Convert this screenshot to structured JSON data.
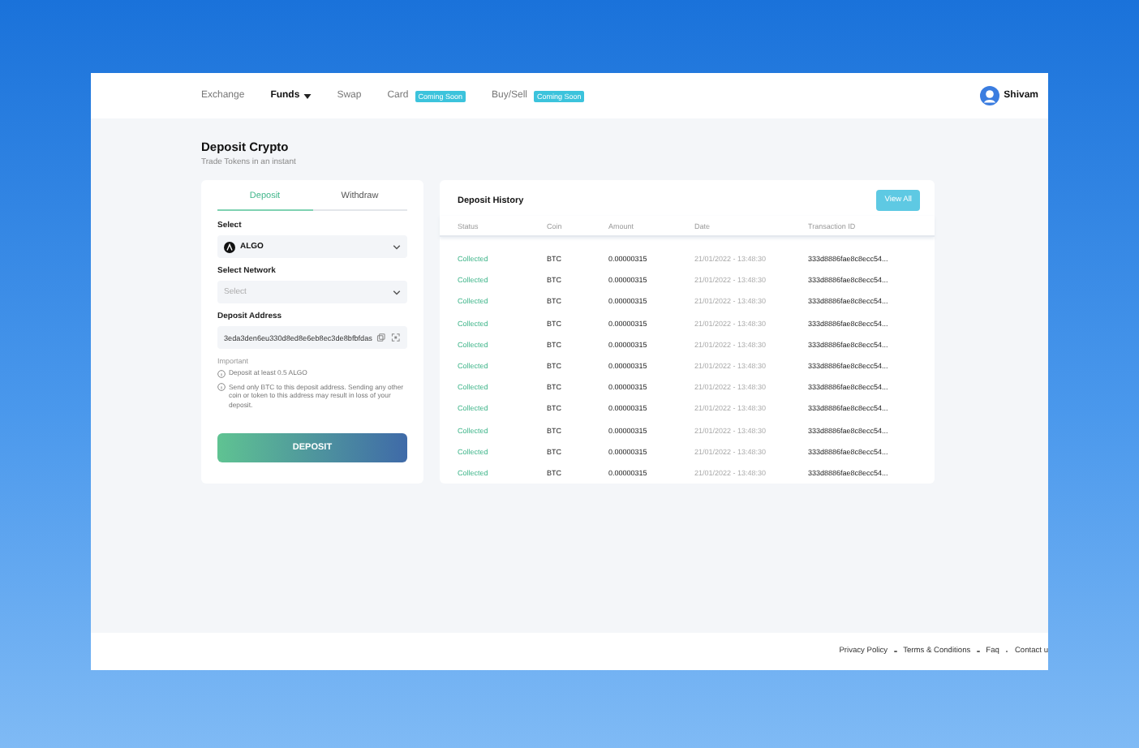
{
  "nav": {
    "items": [
      {
        "label": "Exchange",
        "selected": false
      },
      {
        "label": "Funds",
        "selected": true,
        "dropdown": true
      },
      {
        "label": "Swap",
        "selected": false
      },
      {
        "label": "Card",
        "selected": false,
        "badge": "Coming Soon"
      },
      {
        "label": "Buy/Sell",
        "selected": false,
        "badge": "Coming Soon"
      }
    ],
    "user": "Shivam"
  },
  "page": {
    "title": "Deposit Crypto",
    "subtitle": "Trade Tokens in an instant"
  },
  "deposit": {
    "tabs": [
      {
        "label": "Deposit",
        "selected": true
      },
      {
        "label": "Withdraw",
        "selected": false
      }
    ],
    "fields": [
      {
        "label": "Select",
        "kind": "coin",
        "value": "ALGO"
      },
      {
        "label": "Select Network",
        "kind": "select",
        "placeholder": "Select"
      },
      {
        "label": "Deposit Address",
        "kind": "address",
        "value": "3eda3den6eu330d8ed8e6eb8ec3de8bfbfdas"
      }
    ],
    "notes_heading": "Important",
    "notes": [
      "Deposit at least 0.5 ALGO",
      "Send only BTC to this deposit address. Sending any other coin or token to this address may result in loss of your deposit."
    ],
    "button": "DEPOSIT"
  },
  "history": {
    "title": "Deposit History",
    "view_all": "View All",
    "columns": [
      "Status",
      "Coin",
      "Amount",
      "Date",
      "Transaction ID"
    ],
    "rows": [
      [
        "Collected",
        "BTC",
        "0.00000315",
        "21/01/2022 - 13:48:30",
        "333d8886fae8c8ecc54..."
      ],
      [
        "Collected",
        "BTC",
        "0.00000315",
        "21/01/2022 - 13:48:30",
        "333d8886fae8c8ecc54..."
      ],
      [
        "Collected",
        "BTC",
        "0.00000315",
        "21/01/2022 - 13:48:30",
        "333d8886fae8c8ecc54..."
      ],
      [
        "Collected",
        "BTC",
        "0.00000315",
        "21/01/2022 - 13:48:30",
        "333d8886fae8c8ecc54..."
      ],
      [
        "Collected",
        "BTC",
        "0.00000315",
        "21/01/2022 - 13:48:30",
        "333d8886fae8c8ecc54..."
      ],
      [
        "Collected",
        "BTC",
        "0.00000315",
        "21/01/2022 - 13:48:30",
        "333d8886fae8c8ecc54..."
      ],
      [
        "Collected",
        "BTC",
        "0.00000315",
        "21/01/2022 - 13:48:30",
        "333d8886fae8c8ecc54..."
      ],
      [
        "Collected",
        "BTC",
        "0.00000315",
        "21/01/2022 - 13:48:30",
        "333d8886fae8c8ecc54..."
      ],
      [
        "Collected",
        "BTC",
        "0.00000315",
        "21/01/2022 - 13:48:30",
        "333d8886fae8c8ecc54..."
      ],
      [
        "Collected",
        "BTC",
        "0.00000315",
        "21/01/2022 - 13:48:30",
        "333d8886fae8c8ecc54..."
      ],
      [
        "Collected",
        "BTC",
        "0.00000315",
        "21/01/2022 - 13:48:30",
        "333d8886fae8c8ecc54..."
      ]
    ]
  },
  "footer": [
    "Privacy Policy",
    "Terms & Conditions",
    "Faq",
    "Contact u"
  ]
}
